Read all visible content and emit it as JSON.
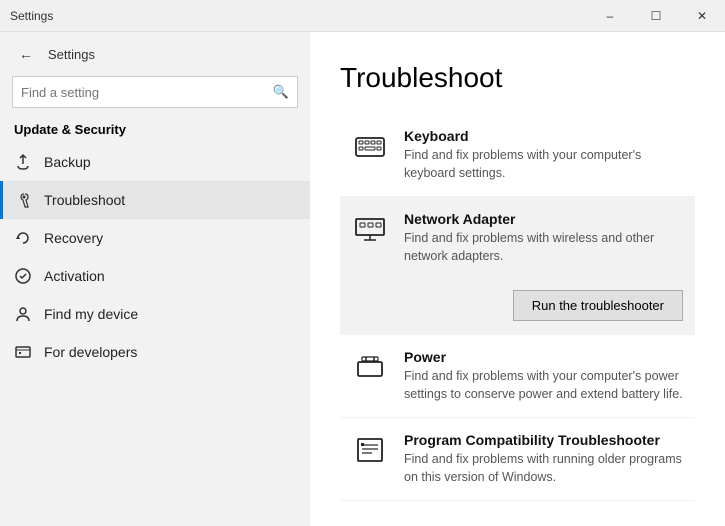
{
  "titlebar": {
    "title": "Settings",
    "minimize_label": "–",
    "maximize_label": "☐",
    "close_label": "✕"
  },
  "sidebar": {
    "back_label": "←",
    "search_placeholder": "Find a setting",
    "search_icon": "🔍",
    "section_title": "Update & Security",
    "items": [
      {
        "id": "backup",
        "label": "Backup",
        "icon": "backup"
      },
      {
        "id": "troubleshoot",
        "label": "Troubleshoot",
        "icon": "wrench",
        "active": true
      },
      {
        "id": "recovery",
        "label": "Recovery",
        "icon": "recovery"
      },
      {
        "id": "activation",
        "label": "Activation",
        "icon": "activation"
      },
      {
        "id": "findmydevice",
        "label": "Find my device",
        "icon": "person"
      },
      {
        "id": "fordevelopers",
        "label": "For developers",
        "icon": "developers"
      }
    ]
  },
  "main": {
    "page_title": "Troubleshoot",
    "items": [
      {
        "id": "keyboard",
        "title": "Keyboard",
        "description": "Find and fix problems with your computer's keyboard settings.",
        "highlighted": false,
        "icon": "keyboard"
      },
      {
        "id": "network-adapter",
        "title": "Network Adapter",
        "description": "Find and fix problems with wireless and other network adapters.",
        "highlighted": true,
        "icon": "network"
      },
      {
        "id": "power",
        "title": "Power",
        "description": "Find and fix problems with your computer's power settings to conserve power and extend battery life.",
        "highlighted": false,
        "icon": "power"
      },
      {
        "id": "program-compat",
        "title": "Program Compatibility Troubleshooter",
        "description": "Find and fix problems with running older programs on this version of Windows.",
        "highlighted": false,
        "icon": "program"
      }
    ],
    "run_btn_label": "Run the troubleshooter"
  }
}
